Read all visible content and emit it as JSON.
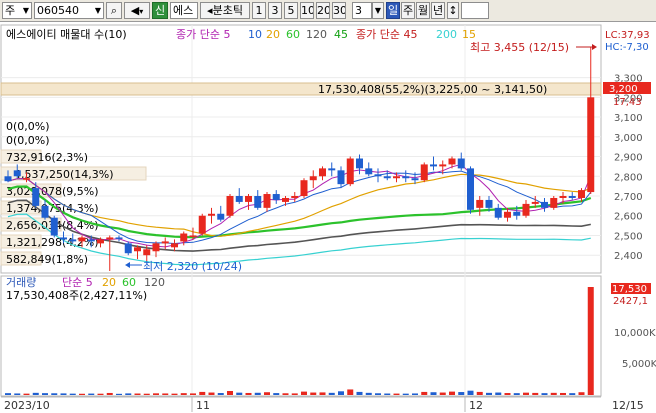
{
  "toolbar": {
    "market": "주",
    "code": "060540",
    "badge": "신",
    "stock_name": "에스",
    "period_label": "분초틱",
    "periods": [
      "1",
      "3",
      "5",
      "10",
      "20",
      "30"
    ],
    "interval_value": "3",
    "tf_day": "일",
    "tf_week": "주",
    "tf_month": "월",
    "tf_year": "년"
  },
  "price_panel": {
    "indicator_label": "에스에이티 매물대 수(10)",
    "ma_label": "종가 단순 5",
    "ma_periods": [
      "10",
      "20",
      "60",
      "120",
      "45"
    ],
    "ma2_label": "종가 단순 45",
    "ma2_periods": [
      "200",
      "15"
    ],
    "lc_label": "LC:37,93",
    "hc_label": "HC:-7,30",
    "high_annotation": "최고 3,455 (12/15)",
    "low_annotation": "최저 2,320 (10/24)",
    "current_price": "3,200",
    "current_change": "17,43",
    "volume_profile": [
      "17,530,408(55,2%)(3,225,00 ~ 3,141,50)",
      "0(0,0%)",
      "0(0,0%)",
      "732,916(2,3%)",
      "4,537,250(14,3%)",
      "3,029,078(9,5%)",
      "1,374,075(4,3%)",
      "2,656,034(8,4%)",
      "1,321,298(4,2%)",
      "582,849(1,8%)"
    ],
    "price_ticks": [
      "3,300",
      "3,200",
      "3,100",
      "3,000",
      "2,900",
      "2,800",
      "2,700",
      "2,600",
      "2,500",
      "2,400"
    ]
  },
  "volume_panel": {
    "label": "거래량",
    "ma_label": "단순 5",
    "ma_periods": [
      "20",
      "60",
      "120"
    ],
    "value_label": "17,530,408주(2,427,11%)",
    "current_label": "17,530",
    "current_pct": "2427,1",
    "ticks": [
      "10,000K",
      "5,000K"
    ]
  },
  "x_axis": {
    "labels": [
      "2023/10",
      "11",
      "12",
      "12/15"
    ]
  },
  "colors": {
    "up": "#e8281e",
    "down": "#1f5fd0",
    "ma5": "#b021b0",
    "ma20": "#e1a100",
    "ma60": "#2cc22c",
    "ma120": "#555555",
    "ma45": "#37d1d1"
  },
  "chart_data": {
    "type": "candlestick",
    "price_scale": [
      2320,
      3455
    ],
    "candles": [
      {
        "o": 2800,
        "h": 2830,
        "l": 2770,
        "c": 2775,
        "v": 300
      },
      {
        "o": 2830,
        "h": 2860,
        "l": 2790,
        "c": 2800,
        "v": 250
      },
      {
        "o": 2790,
        "h": 2820,
        "l": 2770,
        "c": 2790,
        "v": 220
      },
      {
        "o": 2740,
        "h": 2770,
        "l": 2640,
        "c": 2650,
        "v": 350
      },
      {
        "o": 2650,
        "h": 2680,
        "l": 2580,
        "c": 2590,
        "v": 300
      },
      {
        "o": 2590,
        "h": 2600,
        "l": 2490,
        "c": 2500,
        "v": 280
      },
      {
        "o": 2490,
        "h": 2520,
        "l": 2460,
        "c": 2480,
        "v": 260
      },
      {
        "o": 2480,
        "h": 2510,
        "l": 2460,
        "c": 2470,
        "v": 220
      },
      {
        "o": 2470,
        "h": 2500,
        "l": 2440,
        "c": 2490,
        "v": 200
      },
      {
        "o": 2480,
        "h": 2500,
        "l": 2440,
        "c": 2470,
        "v": 230
      },
      {
        "o": 2460,
        "h": 2490,
        "l": 2440,
        "c": 2480,
        "v": 210
      },
      {
        "o": 2480,
        "h": 2500,
        "l": 2320,
        "c": 2490,
        "v": 330
      },
      {
        "o": 2490,
        "h": 2500,
        "l": 2470,
        "c": 2485,
        "v": 190
      },
      {
        "o": 2460,
        "h": 2470,
        "l": 2400,
        "c": 2410,
        "v": 260
      },
      {
        "o": 2420,
        "h": 2450,
        "l": 2380,
        "c": 2440,
        "v": 240
      },
      {
        "o": 2400,
        "h": 2450,
        "l": 2370,
        "c": 2430,
        "v": 210
      },
      {
        "o": 2420,
        "h": 2470,
        "l": 2390,
        "c": 2460,
        "v": 270
      },
      {
        "o": 2460,
        "h": 2490,
        "l": 2430,
        "c": 2470,
        "v": 250
      },
      {
        "o": 2440,
        "h": 2480,
        "l": 2420,
        "c": 2460,
        "v": 220
      },
      {
        "o": 2470,
        "h": 2520,
        "l": 2450,
        "c": 2510,
        "v": 300
      },
      {
        "o": 2500,
        "h": 2540,
        "l": 2480,
        "c": 2500,
        "v": 260
      },
      {
        "o": 2510,
        "h": 2610,
        "l": 2500,
        "c": 2600,
        "v": 500
      },
      {
        "o": 2600,
        "h": 2640,
        "l": 2560,
        "c": 2610,
        "v": 400
      },
      {
        "o": 2610,
        "h": 2650,
        "l": 2570,
        "c": 2580,
        "v": 320
      },
      {
        "o": 2600,
        "h": 2710,
        "l": 2590,
        "c": 2700,
        "v": 650
      },
      {
        "o": 2700,
        "h": 2740,
        "l": 2660,
        "c": 2670,
        "v": 380
      },
      {
        "o": 2670,
        "h": 2710,
        "l": 2630,
        "c": 2700,
        "v": 330
      },
      {
        "o": 2700,
        "h": 2730,
        "l": 2630,
        "c": 2640,
        "v": 360
      },
      {
        "o": 2640,
        "h": 2720,
        "l": 2620,
        "c": 2710,
        "v": 450
      },
      {
        "o": 2710,
        "h": 2730,
        "l": 2660,
        "c": 2680,
        "v": 310
      },
      {
        "o": 2670,
        "h": 2700,
        "l": 2650,
        "c": 2690,
        "v": 280
      },
      {
        "o": 2690,
        "h": 2720,
        "l": 2670,
        "c": 2700,
        "v": 260
      },
      {
        "o": 2700,
        "h": 2790,
        "l": 2690,
        "c": 2780,
        "v": 550
      },
      {
        "o": 2780,
        "h": 2830,
        "l": 2740,
        "c": 2800,
        "v": 400
      },
      {
        "o": 2800,
        "h": 2850,
        "l": 2780,
        "c": 2840,
        "v": 420
      },
      {
        "o": 2840,
        "h": 2870,
        "l": 2800,
        "c": 2830,
        "v": 350
      },
      {
        "o": 2830,
        "h": 2850,
        "l": 2740,
        "c": 2760,
        "v": 600
      },
      {
        "o": 2760,
        "h": 2900,
        "l": 2750,
        "c": 2890,
        "v": 900
      },
      {
        "o": 2890,
        "h": 2910,
        "l": 2810,
        "c": 2840,
        "v": 500
      },
      {
        "o": 2840,
        "h": 2870,
        "l": 2800,
        "c": 2810,
        "v": 350
      },
      {
        "o": 2810,
        "h": 2840,
        "l": 2770,
        "c": 2800,
        "v": 280
      },
      {
        "o": 2800,
        "h": 2830,
        "l": 2780,
        "c": 2790,
        "v": 240
      },
      {
        "o": 2790,
        "h": 2820,
        "l": 2770,
        "c": 2800,
        "v": 230
      },
      {
        "o": 2800,
        "h": 2830,
        "l": 2770,
        "c": 2790,
        "v": 220
      },
      {
        "o": 2790,
        "h": 2820,
        "l": 2760,
        "c": 2780,
        "v": 250
      },
      {
        "o": 2780,
        "h": 2870,
        "l": 2770,
        "c": 2860,
        "v": 500
      },
      {
        "o": 2860,
        "h": 2900,
        "l": 2830,
        "c": 2850,
        "v": 450
      },
      {
        "o": 2850,
        "h": 2880,
        "l": 2810,
        "c": 2860,
        "v": 400
      },
      {
        "o": 2860,
        "h": 2900,
        "l": 2840,
        "c": 2890,
        "v": 550
      },
      {
        "o": 2890,
        "h": 2920,
        "l": 2830,
        "c": 2840,
        "v": 480
      },
      {
        "o": 2840,
        "h": 2850,
        "l": 2610,
        "c": 2630,
        "v": 700
      },
      {
        "o": 2640,
        "h": 2700,
        "l": 2600,
        "c": 2680,
        "v": 500
      },
      {
        "o": 2680,
        "h": 2700,
        "l": 2620,
        "c": 2640,
        "v": 350
      },
      {
        "o": 2640,
        "h": 2660,
        "l": 2580,
        "c": 2590,
        "v": 400
      },
      {
        "o": 2590,
        "h": 2640,
        "l": 2570,
        "c": 2620,
        "v": 320
      },
      {
        "o": 2620,
        "h": 2650,
        "l": 2580,
        "c": 2600,
        "v": 300
      },
      {
        "o": 2600,
        "h": 2680,
        "l": 2590,
        "c": 2660,
        "v": 380
      },
      {
        "o": 2660,
        "h": 2700,
        "l": 2640,
        "c": 2670,
        "v": 340
      },
      {
        "o": 2670,
        "h": 2690,
        "l": 2620,
        "c": 2640,
        "v": 300
      },
      {
        "o": 2640,
        "h": 2700,
        "l": 2630,
        "c": 2690,
        "v": 350
      },
      {
        "o": 2690,
        "h": 2720,
        "l": 2660,
        "c": 2700,
        "v": 330
      },
      {
        "o": 2700,
        "h": 2720,
        "l": 2680,
        "c": 2690,
        "v": 300
      },
      {
        "o": 2690,
        "h": 2740,
        "l": 2670,
        "c": 2730,
        "v": 450
      },
      {
        "o": 2720,
        "h": 3455,
        "l": 2710,
        "c": 3200,
        "v": 17530
      }
    ]
  }
}
